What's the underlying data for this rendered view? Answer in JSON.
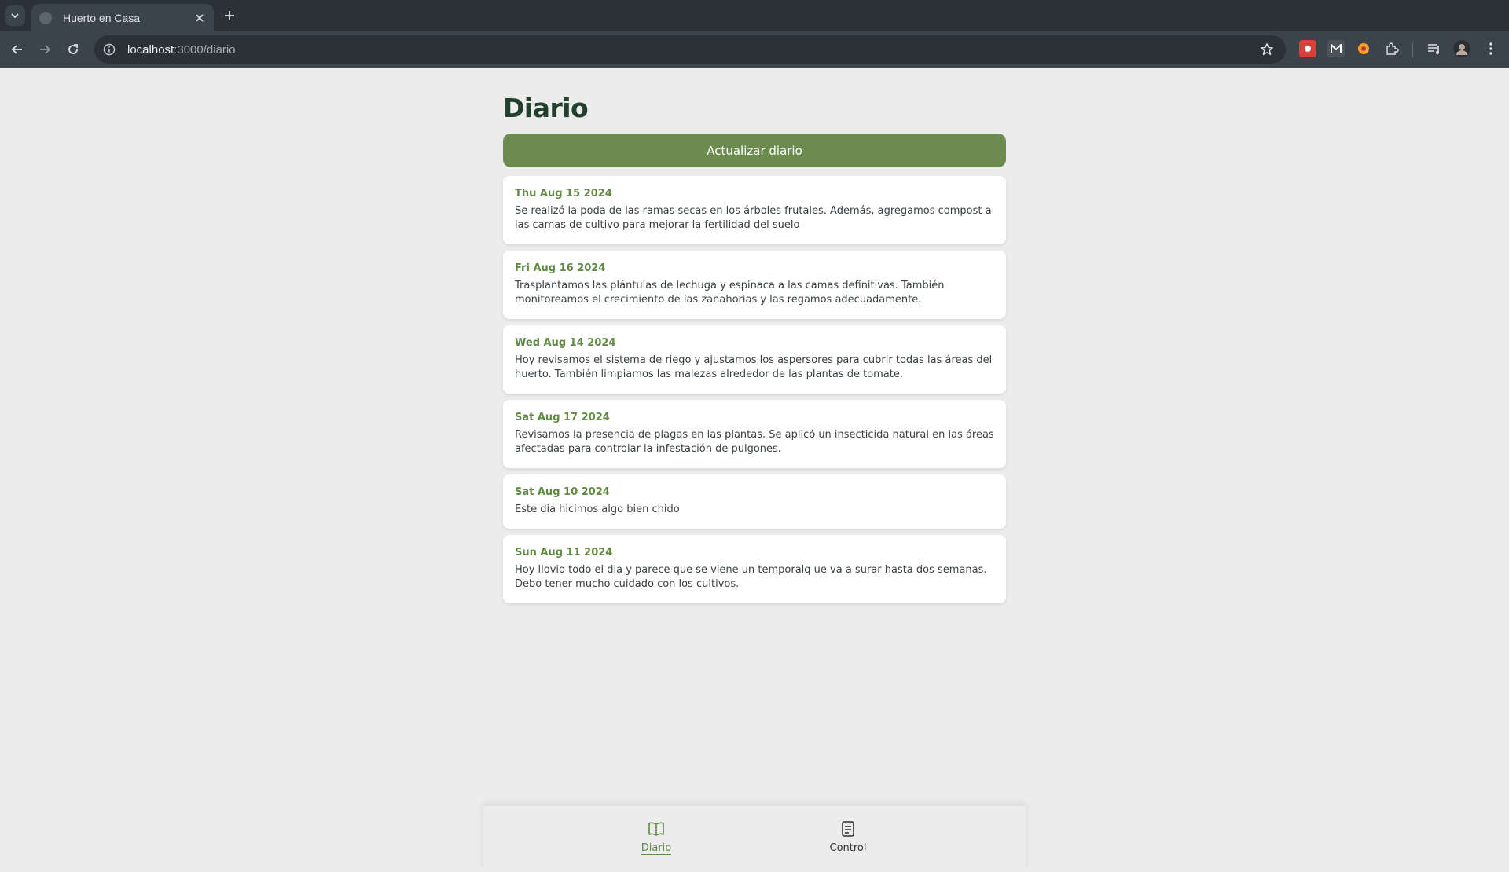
{
  "browser": {
    "tab_title": "Huerto en Casa",
    "url_host": "localhost",
    "url_path": ":3000/diario"
  },
  "page": {
    "title": "Diario",
    "update_button": "Actualizar diario"
  },
  "entries": [
    {
      "date": "Thu Aug 15 2024",
      "text": "Se realizó la poda de las ramas secas en los árboles frutales. Además, agregamos compost a las camas de cultivo para mejorar la fertilidad del suelo"
    },
    {
      "date": "Fri Aug 16 2024",
      "text": "Trasplantamos las plántulas de lechuga y espinaca a las camas definitivas. También monitoreamos el crecimiento de las zanahorias y las regamos adecuadamente."
    },
    {
      "date": "Wed Aug 14 2024",
      "text": "Hoy revisamos el sistema de riego y ajustamos los aspersores para cubrir todas las áreas del huerto. También limpiamos las malezas alrededor de las plantas de tomate."
    },
    {
      "date": "Sat Aug 17 2024",
      "text": "Revisamos la presencia de plagas en las plantas. Se aplicó un insecticida natural en las áreas afectadas para controlar la infestación de pulgones."
    },
    {
      "date": "Sat Aug 10 2024",
      "text": "Este dia hicimos algo bien chido"
    },
    {
      "date": "Sun Aug 11 2024",
      "text": "Hoy llovio todo el dia y parece que se viene un temporalq ue va a surar hasta dos semanas. Debo tener mucho cuidado con los cultivos."
    }
  ],
  "bottom_nav": {
    "diario": {
      "label": "Diario",
      "icon": "book-open-icon"
    },
    "control": {
      "label": "Control",
      "icon": "clipboard-list-icon"
    }
  },
  "colors": {
    "accent": "#6b8c4e",
    "date_green": "#5f8a42",
    "title": "#22412c",
    "page_bg": "#ececec"
  }
}
